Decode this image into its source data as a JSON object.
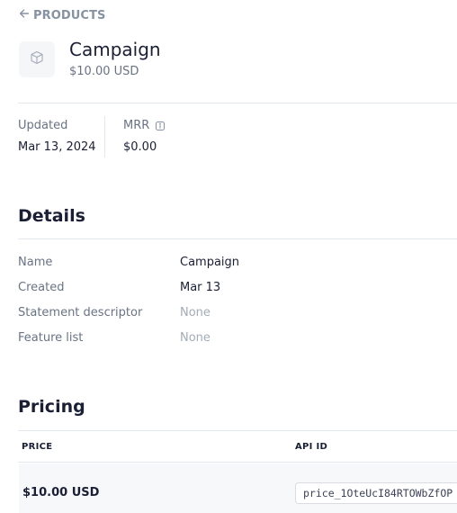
{
  "breadcrumb": {
    "label": "PRODUCTS",
    "icon": "arrow-left-icon"
  },
  "product": {
    "icon": "box-icon",
    "name": "Campaign",
    "price": "$10.00 USD"
  },
  "stats": {
    "updated_label": "Updated",
    "updated_value": "Mar 13, 2024",
    "mrr_label": "MRR",
    "mrr_value": "$0.00",
    "mrr_info_icon": "info-icon"
  },
  "details": {
    "title": "Details",
    "rows": [
      {
        "key": "Name",
        "value": "Campaign"
      },
      {
        "key": "Created",
        "value": "Mar 13"
      },
      {
        "key": "Statement descriptor",
        "value": "None"
      },
      {
        "key": "Feature list",
        "value": "None"
      }
    ]
  },
  "pricing": {
    "title": "Pricing",
    "columns": [
      "PRICE",
      "API ID"
    ],
    "rows": [
      {
        "price": "$10.00 USD",
        "api_id": "price_1OteUcI84RTOWbZfOP"
      }
    ]
  },
  "colors": {
    "text_primary": "#1a1f36",
    "text_secondary": "#697386",
    "text_muted": "#a3acb9",
    "border": "#e3e8ee",
    "row_bg": "#f7f8fa"
  }
}
